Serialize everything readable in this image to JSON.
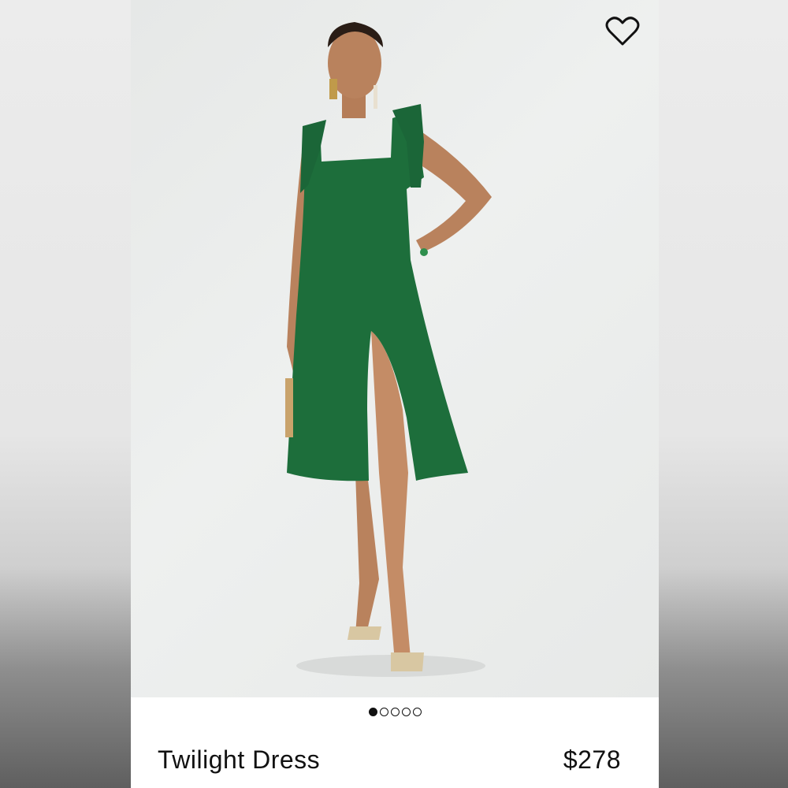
{
  "product": {
    "name": "Twilight Dress",
    "price": "$278",
    "image_alt": "Model wearing green midi dress with tie straps and front slit",
    "favorite_icon": "heart-outline-icon",
    "dress_color": "#1d6e3b"
  },
  "carousel": {
    "total": 5,
    "active_index": 0
  }
}
